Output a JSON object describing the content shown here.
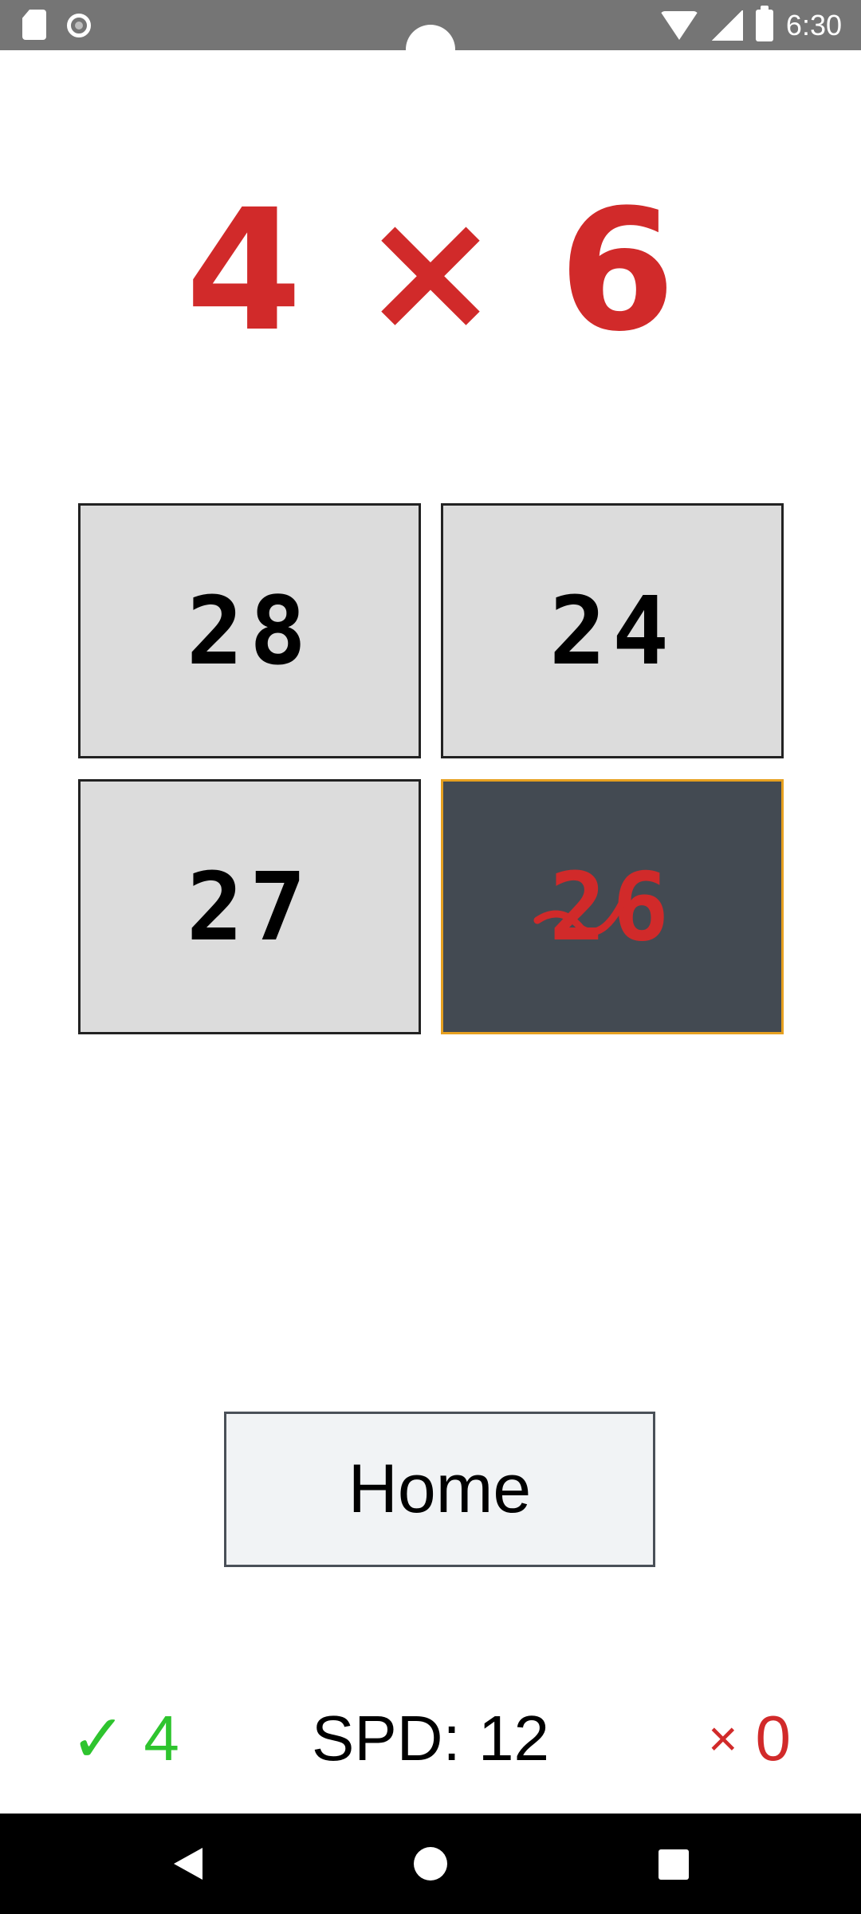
{
  "status_bar": {
    "time": "6:30",
    "icons": [
      "sd-card-icon",
      "record-icon",
      "wifi-icon",
      "signal-icon",
      "battery-icon"
    ]
  },
  "problem": {
    "text": "4 × 6",
    "color": "#d12a2a"
  },
  "answers": [
    {
      "value": "28",
      "state": "default"
    },
    {
      "value": "24",
      "state": "default"
    },
    {
      "value": "27",
      "state": "default"
    },
    {
      "value": "26",
      "state": "selected-wrong"
    }
  ],
  "home_button": {
    "label": "Home"
  },
  "score": {
    "correct_icon": "✓",
    "correct_count": "4",
    "speed_label": "SPD: 12",
    "wrong_icon": "×",
    "wrong_count": "0",
    "correct_color": "#2ec42e",
    "wrong_color": "#d12a2a"
  },
  "nav_bar": {
    "icons": [
      "back-icon",
      "home-icon",
      "recents-icon"
    ]
  }
}
